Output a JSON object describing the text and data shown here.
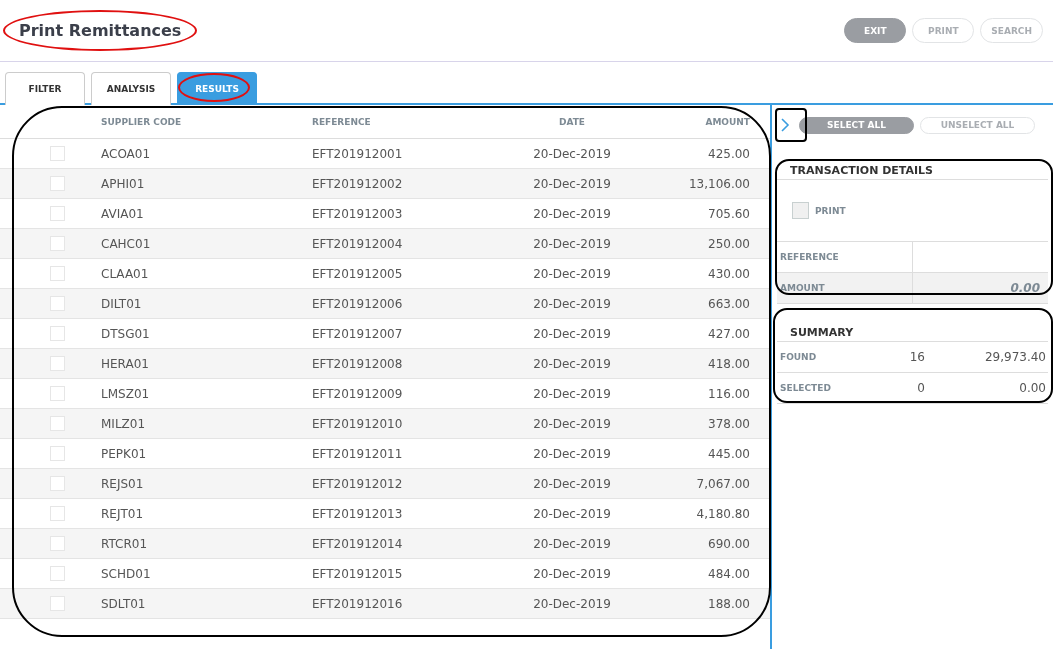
{
  "title": "Print Remittances",
  "actions": [
    {
      "label": "EXIT",
      "disabled": false
    },
    {
      "label": "PRINT",
      "disabled": true
    },
    {
      "label": "SEARCH",
      "disabled": true
    }
  ],
  "tabs": [
    {
      "label": "FILTER",
      "selected": false
    },
    {
      "label": "ANALYSIS",
      "selected": false
    },
    {
      "label": "RESULTS",
      "selected": true
    }
  ],
  "table": {
    "columns": [
      "SUPPLIER CODE",
      "REFERENCE",
      "DATE",
      "AMOUNT"
    ],
    "rows": [
      {
        "checked": false,
        "cells": [
          "ACOA01",
          "EFT201912001",
          "20-Dec-2019",
          "425.00"
        ]
      },
      {
        "checked": false,
        "cells": [
          "APHI01",
          "EFT201912002",
          "20-Dec-2019",
          "13,106.00"
        ]
      },
      {
        "checked": false,
        "cells": [
          "AVIA01",
          "EFT201912003",
          "20-Dec-2019",
          "705.60"
        ]
      },
      {
        "checked": false,
        "cells": [
          "CAHC01",
          "EFT201912004",
          "20-Dec-2019",
          "250.00"
        ]
      },
      {
        "checked": false,
        "cells": [
          "CLAA01",
          "EFT201912005",
          "20-Dec-2019",
          "430.00"
        ]
      },
      {
        "checked": false,
        "cells": [
          "DILT01",
          "EFT201912006",
          "20-Dec-2019",
          "663.00"
        ]
      },
      {
        "checked": false,
        "cells": [
          "DTSG01",
          "EFT201912007",
          "20-Dec-2019",
          "427.00"
        ]
      },
      {
        "checked": false,
        "cells": [
          "HERA01",
          "EFT201912008",
          "20-Dec-2019",
          "418.00"
        ]
      },
      {
        "checked": false,
        "cells": [
          "LMSZ01",
          "EFT201912009",
          "20-Dec-2019",
          "116.00"
        ]
      },
      {
        "checked": false,
        "cells": [
          "MILZ01",
          "EFT201912010",
          "20-Dec-2019",
          "378.00"
        ]
      },
      {
        "checked": false,
        "cells": [
          "PEPK01",
          "EFT201912011",
          "20-Dec-2019",
          "445.00"
        ]
      },
      {
        "checked": false,
        "cells": [
          "REJS01",
          "EFT201912012",
          "20-Dec-2019",
          "7,067.00"
        ]
      },
      {
        "checked": false,
        "cells": [
          "REJT01",
          "EFT201912013",
          "20-Dec-2019",
          "4,180.80"
        ]
      },
      {
        "checked": false,
        "cells": [
          "RTCR01",
          "EFT201912014",
          "20-Dec-2019",
          "690.00"
        ]
      },
      {
        "checked": false,
        "cells": [
          "SCHD01",
          "EFT201912015",
          "20-Dec-2019",
          "484.00"
        ]
      },
      {
        "checked": false,
        "cells": [
          "SDLT01",
          "EFT201912016",
          "20-Dec-2019",
          "188.00"
        ]
      }
    ]
  },
  "selection_buttons": [
    {
      "label": "SELECT ALL",
      "disabled": false
    },
    {
      "label": "UNSELECT ALL",
      "disabled": true
    }
  ],
  "transaction_details": {
    "title": "TRANSACTION DETAILS",
    "print": {
      "label": "PRINT",
      "checked": false
    },
    "fields": [
      {
        "label": "REFERENCE"
      },
      {
        "label": "AMOUNT",
        "value": "0.00"
      }
    ]
  },
  "summary": {
    "title": "SUMMARY",
    "rows": [
      {
        "label": "FOUND",
        "count": "16",
        "total": "29,973.40"
      },
      {
        "label": "SELECTED",
        "count": "0",
        "total": "0.00"
      }
    ]
  }
}
